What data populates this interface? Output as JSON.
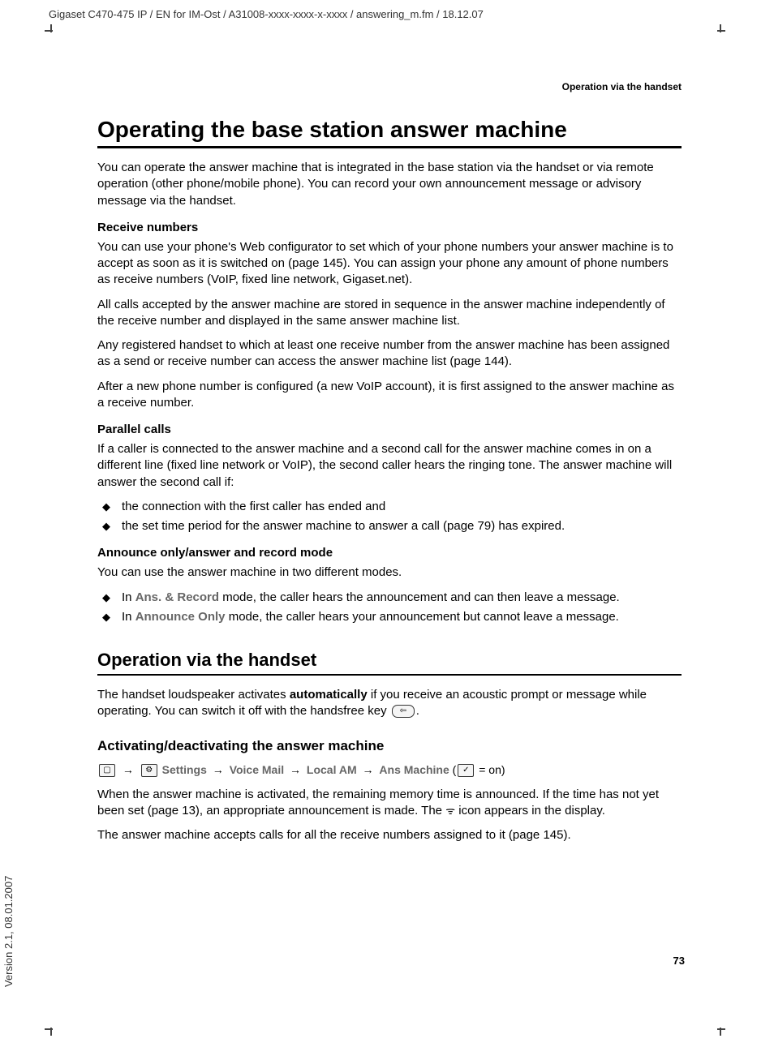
{
  "header": {
    "docpath": "Gigaset C470-475 IP / EN for IM-Ost / A31008-xxxx-xxxx-x-xxxx / answering_m.fm / 18.12.07"
  },
  "page_header_right": "Operation via the handset",
  "h1": "Operating the base station answer machine",
  "intro": "You can operate the answer machine that is integrated in the base station via the handset or via remote operation (other phone/mobile phone). You can record your own announcement message or advisory message via the handset.",
  "recv_head": "Receive numbers",
  "recv_p1": "You can use your phone's Web configurator to set which of your phone numbers your answer machine is to accept as soon as it is switched on (page 145). You can assign your phone any amount of phone numbers as receive numbers (VoIP, fixed line network, Gigaset.net).",
  "recv_p2": "All calls accepted by the answer machine are stored in sequence in the answer machine independently of the receive number and displayed in the same answer machine list.",
  "recv_p3": "Any registered handset to which at least one receive number from the answer machine has been assigned as a send or receive number can access the answer machine list (page 144).",
  "recv_p4": "After a new phone number is configured (a new VoIP account), it is first assigned to the answer machine as a receive number.",
  "par_head": "Parallel calls",
  "par_p1": "If a caller is connected to the answer machine and a second call for the answer machine comes in on a different line (fixed line network or VoIP), the second caller hears the ringing tone. The answer machine will answer the second call if:",
  "par_b1": "the connection with the first caller has ended and",
  "par_b2": "the set time period for the answer machine to answer a call (page 79) has expired.",
  "mode_head": "Announce only/answer and record mode",
  "mode_p1": "You can use the answer machine in two different modes.",
  "mode_b1_pre": "In ",
  "mode_b1_grey": "Ans. & Record",
  "mode_b1_post": " mode, the caller hears the announcement and can then leave a message.",
  "mode_b2_pre": "In ",
  "mode_b2_grey": "Announce Only",
  "mode_b2_post": " mode, the caller hears your announcement but cannot leave a message.",
  "h2": "Operation via the handset",
  "op_p1_a": "The handset loudspeaker activates ",
  "op_p1_bold": "automatically",
  "op_p1_b": " if you receive an acoustic prompt or message while operating. You can switch it off with the handsfree key ",
  "op_p1_end": ".",
  "act_head": "Activating/deactivating the answer machine",
  "nav": {
    "settings": "Settings",
    "voicemail": "Voice Mail",
    "localam": "Local AM",
    "ansmachine": "Ans Machine",
    "on": " = on)"
  },
  "act_p1_a": "When the answer machine is activated, the remaining memory time is announced. If the time has not yet been set (page 13), an appropriate announcement is made. The ",
  "act_p1_b": " icon appears in the display.",
  "act_p2": "The answer machine accepts calls for all the receive numbers assigned to it (page 145).",
  "page_number": "73",
  "version": "Version 2.1, 08.01.2007"
}
